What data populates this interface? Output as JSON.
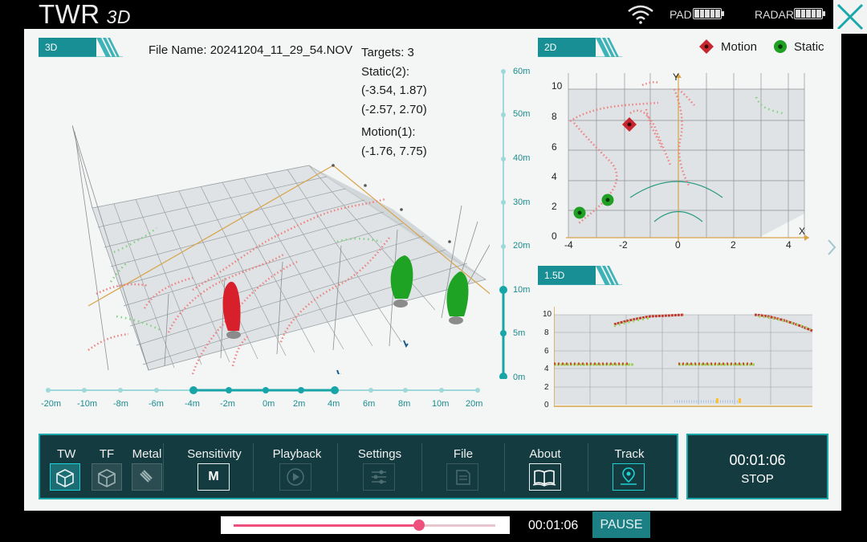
{
  "app": {
    "brand": "TWR",
    "mode": "3D"
  },
  "status_bar": {
    "pad_label": "PAD",
    "radar_label": "RADAR"
  },
  "view3d": {
    "tag": "3D",
    "file_name_label": "File Name:",
    "file_name": "20241204_11_29_54.NOV",
    "targets_label": "Targets: 3",
    "static_label": "Static(2):",
    "static_coords": [
      "(-3.54,  1.87)",
      "(-2.57,  2.70)"
    ],
    "motion_label": "Motion(1):",
    "motion_coords": [
      "(-1.76,  7.75)"
    ],
    "range_ticks": [
      "60m",
      "50m",
      "40m",
      "30m",
      "20m",
      "10m",
      "5m",
      "0m"
    ],
    "range_value_m": 10,
    "width_ticks": [
      "-20m",
      "-10m",
      "-8m",
      "-6m",
      "-4m",
      "-2m",
      "0m",
      "2m",
      "4m",
      "6m",
      "8m",
      "10m",
      "20m"
    ],
    "width_selected": [
      "-4m",
      "4m"
    ]
  },
  "view2d": {
    "tag": "2D",
    "legend": {
      "motion": "Motion",
      "static": "Static"
    },
    "y_label": "Y",
    "x_label": "X",
    "y_ticks": [
      "10",
      "8",
      "6",
      "4",
      "2",
      "0"
    ],
    "x_ticks": [
      "-4",
      "-2",
      "0",
      "2",
      "4"
    ]
  },
  "view15d": {
    "tag": "1.5D",
    "y_ticks": [
      "10",
      "8",
      "6",
      "4",
      "2",
      "0"
    ]
  },
  "toolbar": {
    "tw": "TW",
    "tf": "TF",
    "metal": "Metal",
    "sensitivity": "Sensitivity",
    "sensitivity_value": "M",
    "playback": "Playback",
    "settings": "Settings",
    "file": "File",
    "about": "About",
    "track": "Track"
  },
  "timer": {
    "time": "00:01:06",
    "stop_label": "STOP"
  },
  "playback_bar": {
    "time": "00:01:06",
    "pause_label": "PAUSE",
    "progress": 0.71
  },
  "colors": {
    "accent": "#1aa8aa",
    "motion": "#d81f2c",
    "static": "#21a524",
    "track": "#ef7f7f",
    "slider": "#ef4f7c"
  }
}
